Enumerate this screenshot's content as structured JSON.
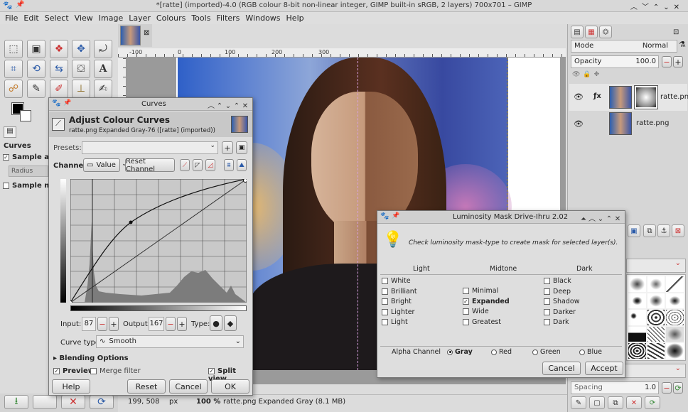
{
  "titlebar": {
    "title": "*[ratte] (imported)-4.0 (RGB colour 8-bit non-linear integer, GIMP built-in sRGB, 2 layers) 700x701 – GIMP"
  },
  "menu": [
    "File",
    "Edit",
    "Select",
    "View",
    "Image",
    "Layer",
    "Colours",
    "Tools",
    "Filters",
    "Windows",
    "Help"
  ],
  "ruler": [
    "-100",
    "0",
    "100",
    "200",
    "300"
  ],
  "left_panel": {
    "tab": "Curves",
    "option1": "Sample average",
    "option1_field": "Radius",
    "option2": "Sample merged"
  },
  "statusbar": {
    "coords": "199, 508",
    "unit": "px",
    "zoom": "100 %",
    "info": "ratte.png Expanded Gray (8.1 MB)"
  },
  "layers_panel": {
    "mode_label": "Mode",
    "mode_value": "Normal",
    "opacity_label": "Opacity",
    "opacity_value": "100.0",
    "layers": [
      {
        "name": "ratte.png"
      },
      {
        "name": "ratte.png"
      }
    ],
    "spacing_label": "Spacing",
    "spacing_value": "1.0"
  },
  "curves": {
    "window_title": "Curves",
    "header_title": "Adjust Colour Curves",
    "header_sub": "ratte.png Expanded Gray-76 ([ratte] (imported))",
    "presets_label": "Presets:",
    "channel_label": "Channel:",
    "channel_value": "Value",
    "reset_channel": "Reset Channel",
    "input_label": "Input:",
    "input_value": "87",
    "output_label": "Output:",
    "output_value": "167",
    "type_label": "Type:",
    "curve_type_label": "Curve type:",
    "curve_type_value": "Smooth",
    "blending": "Blending Options",
    "preview": "Preview",
    "merge": "Merge filter",
    "split": "Split view",
    "help": "Help",
    "reset": "Reset",
    "cancel": "Cancel",
    "ok": "OK"
  },
  "lumi": {
    "window_title": "Luminosity Mask Drive-Ihru 2.02",
    "message": "Check luminosity mask-type to create mask for selected layer(s).",
    "col_light": "Light",
    "col_mid": "Midtone",
    "col_dark": "Dark",
    "light": [
      "White",
      "Brilliant",
      "Bright",
      "Lighter",
      "Light"
    ],
    "mid": [
      "Minimal",
      "Expanded",
      "Wide",
      "Greatest"
    ],
    "dark": [
      "Black",
      "Deep",
      "Shadow",
      "Darker",
      "Dark"
    ],
    "alpha_label": "Alpha Channel",
    "channels": [
      "Gray",
      "Red",
      "Green",
      "Blue"
    ],
    "cancel": "Cancel",
    "accept": "Accept"
  },
  "colors": {
    "accent": "#c03a3a",
    "title_bg": "#d9d9d9",
    "canvas_bg": "#9a9a9a"
  }
}
